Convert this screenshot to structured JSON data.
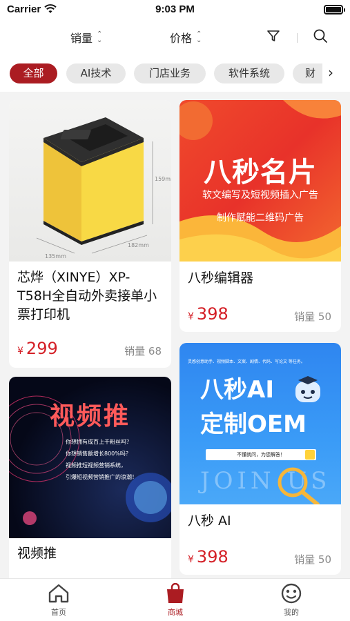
{
  "status": {
    "carrier": "Carrier",
    "time": "9:03 PM"
  },
  "filters": {
    "sales": "销量",
    "price": "价格"
  },
  "categories": [
    "全部",
    "AI技术",
    "门店业务",
    "软件系统",
    "财"
  ],
  "products": [
    {
      "name": "芯烨（XINYE）XP-T58H全自动外卖接单小票打印机",
      "currency": "¥",
      "price": "299",
      "sales": "销量 68"
    },
    {
      "name": "八秒编辑器",
      "currency": "¥",
      "price": "398",
      "sales": "销量 50",
      "banner": {
        "title": "八秒名片",
        "line1": "软文编写及短视频插入广告",
        "line2": "制作赋能二维码广告"
      }
    },
    {
      "name": "视频推",
      "banner": {
        "title": "视频推",
        "line1": "你想拥有成百上千粉丝吗？",
        "line2": "你想销售额增长800%吗？",
        "line3": "视频推短视频营销系统，",
        "line4": "引爆短视频营销推广的浪潮！"
      }
    },
    {
      "name": "八秒 AI",
      "currency": "¥",
      "price": "398",
      "sales": "销量 50",
      "banner": {
        "tagline": "灵感创意助手、视频脚本、文案、剧情、代码、写论文 等任务。",
        "title1": "八秒AI",
        "title2": "定制OEM",
        "question": "不懂就问，为您解答！",
        "watermark": "JOIN US"
      }
    }
  ],
  "printer_labels": {
    "w": "159mm",
    "d": "182mm",
    "h": "135mm"
  },
  "tabbar": [
    {
      "label": "首页",
      "icon": "home-icon"
    },
    {
      "label": "商城",
      "icon": "shopping-bag-icon"
    },
    {
      "label": "我的",
      "icon": "smiley-face-icon"
    }
  ],
  "colors": {
    "accent": "#ab1c22",
    "price": "#d41f26"
  }
}
